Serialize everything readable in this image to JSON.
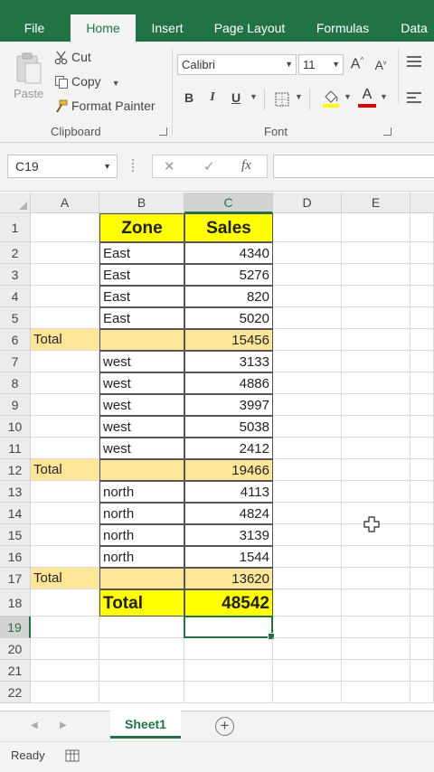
{
  "ribbon": {
    "tabs": [
      "File",
      "Home",
      "Insert",
      "Page Layout",
      "Formulas",
      "Data"
    ],
    "active_tab": "Home",
    "clipboard": {
      "paste_label": "Paste",
      "cut_label": "Cut",
      "copy_label": "Copy",
      "format_painter_label": "Format Painter",
      "group_label": "Clipboard"
    },
    "font": {
      "font_name": "Calibri",
      "font_size": "11",
      "group_label": "Font",
      "bold": "B",
      "italic": "I",
      "underline": "U",
      "grow": "A",
      "shrink": "A",
      "font_color": "A"
    }
  },
  "formula_bar": {
    "name_box": "C19",
    "fx_label": "fx",
    "cancel_symbol": "✕",
    "enter_symbol": "✓",
    "content": ""
  },
  "columns": [
    "A",
    "B",
    "C",
    "D",
    "E"
  ],
  "selected_column": "C",
  "selected_row": "19",
  "header_row": {
    "zone": "Zone",
    "sales": "Sales"
  },
  "rows": [
    {
      "num": "1"
    },
    {
      "num": "2",
      "zone": "East",
      "sales": "4340"
    },
    {
      "num": "3",
      "zone": "East",
      "sales": "5276"
    },
    {
      "num": "4",
      "zone": "East",
      "sales": "820"
    },
    {
      "num": "5",
      "zone": "East",
      "sales": "5020"
    },
    {
      "num": "6",
      "label": "Total",
      "sales": "15456",
      "kind": "subtotal"
    },
    {
      "num": "7",
      "zone": "west",
      "sales": "3133"
    },
    {
      "num": "8",
      "zone": "west",
      "sales": "4886"
    },
    {
      "num": "9",
      "zone": "west",
      "sales": "3997"
    },
    {
      "num": "10",
      "zone": "west",
      "sales": "5038"
    },
    {
      "num": "11",
      "zone": "west",
      "sales": "2412"
    },
    {
      "num": "12",
      "label": "Total",
      "sales": "19466",
      "kind": "subtotal"
    },
    {
      "num": "13",
      "zone": "north",
      "sales": "4113"
    },
    {
      "num": "14",
      "zone": "north",
      "sales": "4824"
    },
    {
      "num": "15",
      "zone": "north",
      "sales": "3139"
    },
    {
      "num": "16",
      "zone": "north",
      "sales": "1544"
    },
    {
      "num": "17",
      "label": "Total",
      "sales": "13620",
      "kind": "subtotal"
    },
    {
      "num": "18",
      "zone": "Total",
      "sales": "48542",
      "kind": "grand"
    },
    {
      "num": "19"
    },
    {
      "num": "20"
    },
    {
      "num": "21"
    },
    {
      "num": "22"
    }
  ],
  "sheet_tab": "Sheet1",
  "status": "Ready",
  "colors": {
    "accent": "#217346",
    "subtotal_fill": "#ffe699",
    "header_fill": "#ffff00"
  }
}
